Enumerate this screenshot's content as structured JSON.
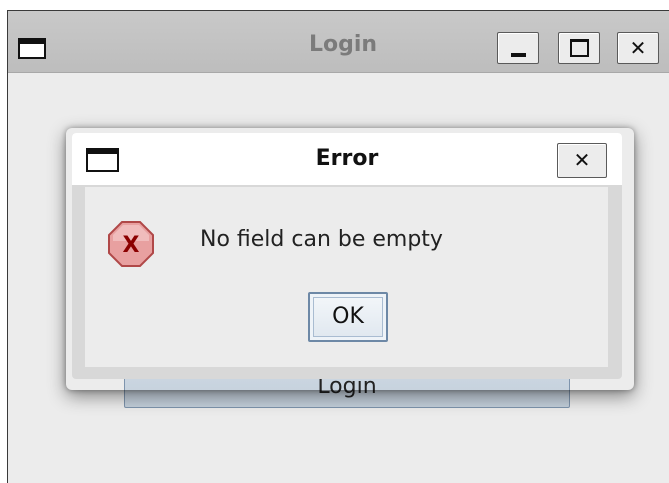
{
  "main_window": {
    "title": "Login",
    "controls": {
      "minimize_icon": "minimize-icon",
      "maximize_icon": "maximize-icon",
      "close_label": "✕"
    },
    "login_button_label": "Login"
  },
  "dialog": {
    "title": "Error",
    "close_label": "✕",
    "icon": "error-icon",
    "message": "No field can be empty",
    "ok_label": "OK"
  },
  "colors": {
    "window_bg": "#ececec",
    "titlebar_bg": "#c4c4c4",
    "dialog_titlebar_bg": "#ffffff",
    "error_icon_fill": "#e8a0a0",
    "error_icon_stroke": "#b04848",
    "error_icon_glyph": "#8b0000",
    "button_border": "#6d88a6"
  }
}
